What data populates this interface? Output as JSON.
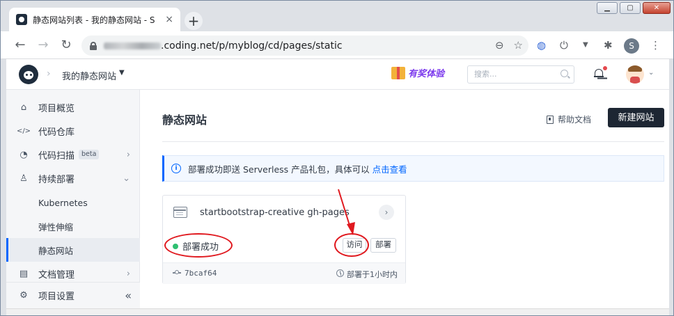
{
  "browser": {
    "tab_title": "静态网站列表 - 我的静态网站 - S",
    "tab_close": "×",
    "new_tab": "+",
    "url_visible": ".coding.net/p/myblog/cd/pages/static",
    "profile_initial": "S"
  },
  "header": {
    "project_name": "我的静态网站",
    "promo_text": "有奖体验",
    "search_placeholder": "搜索..."
  },
  "sidebar": {
    "items": [
      {
        "label": "项目概览",
        "icon": "home-icon"
      },
      {
        "label": "代码仓库",
        "icon": "code-icon"
      },
      {
        "label": "代码扫描",
        "icon": "scan-icon",
        "badge": "beta"
      },
      {
        "label": "持续部署",
        "icon": "rocket-icon"
      },
      {
        "label": "Kubernetes"
      },
      {
        "label": "弹性伸缩"
      },
      {
        "label": "静态网站",
        "active": true
      },
      {
        "label": "文档管理",
        "icon": "document-icon"
      }
    ],
    "settings_label": "项目设置",
    "collapse_glyph": "«"
  },
  "main": {
    "title": "静态网站",
    "help_label": "帮助文档",
    "new_site_label": "新建网站",
    "notice_text": "部署成功即送 Serverless 产品礼包，具体可以",
    "notice_link": "点击查看",
    "card": {
      "name": "startbootstrap-creative gh-pages",
      "status": "部署成功",
      "visit_label": "访问",
      "deploy_label": "部署",
      "commit": "7bcaf64",
      "deploy_time": "部署于1小时内"
    }
  },
  "colors": {
    "accent": "#0066ff",
    "primary_button": "#1d2633",
    "success": "#2fbf71",
    "annotation": "#e0191f"
  }
}
